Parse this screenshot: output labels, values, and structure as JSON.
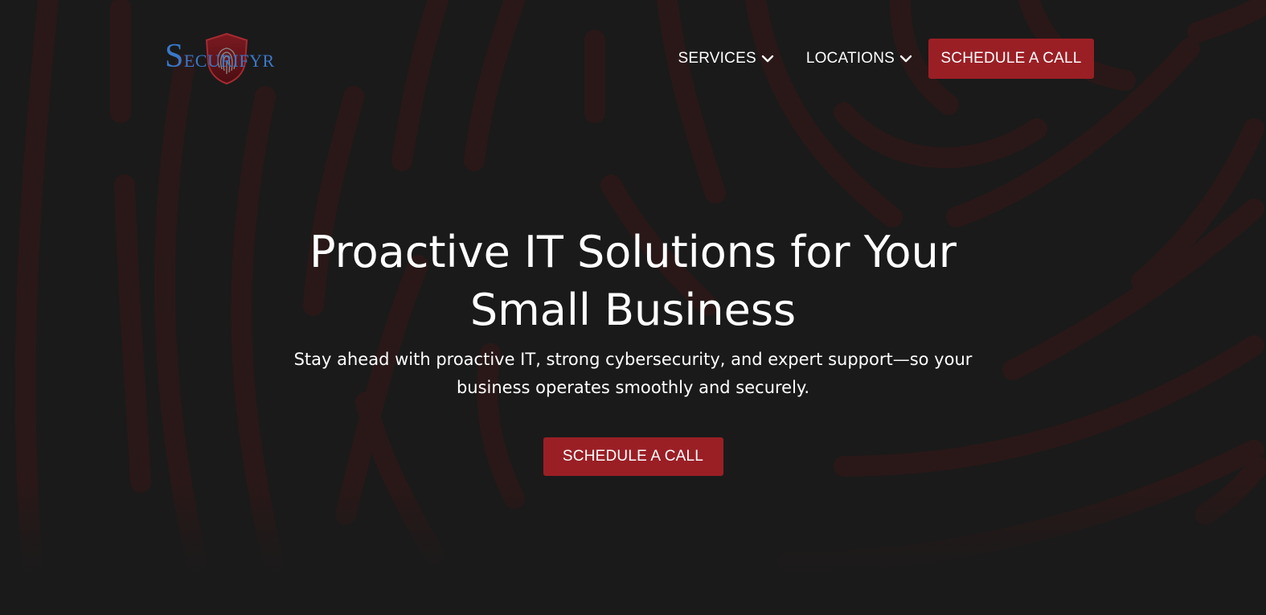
{
  "brand": {
    "logo_initial": "S",
    "logo_rest": "ECURIFYR"
  },
  "nav": {
    "items": [
      {
        "label": "SERVICES",
        "icon": "chevron-down-icon"
      },
      {
        "label": "LOCATIONS",
        "icon": "chevron-down-icon"
      }
    ],
    "cta_label": "SCHEDULE A CALL"
  },
  "hero": {
    "headline": "Proactive IT Solutions for Your Small Business",
    "subheadline": "Stay ahead with proactive IT, strong cybersecurity, and expert support—so your business operates smoothly and securely.",
    "cta_label": "SCHEDULE A CALL"
  },
  "colors": {
    "background": "#1a1a1a",
    "accent": "#9a1f25",
    "pattern": "#2a1818",
    "logo_blue": "#3a78c9"
  }
}
